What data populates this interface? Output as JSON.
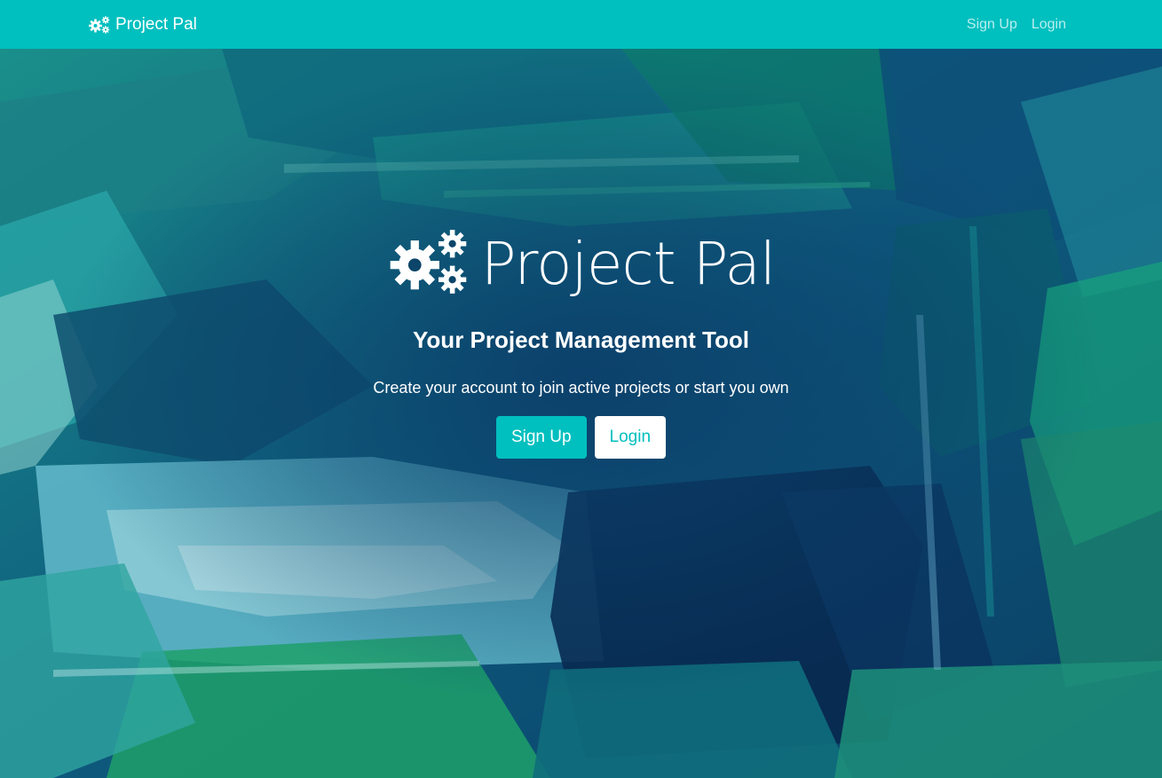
{
  "navbar": {
    "brand": "Project Pal",
    "brand_icon": "cogs-icon",
    "links": [
      "Sign Up",
      "Login"
    ]
  },
  "hero": {
    "title": "Project Pal",
    "title_icon": "cogs-icon",
    "tagline": "Your Project Management Tool",
    "subtext": "Create your account to join active projects or start you own",
    "buttons": {
      "signup": "Sign Up",
      "login": "Login"
    }
  },
  "colors": {
    "accent": "#00bfbf",
    "text_light": "#ffffff"
  }
}
